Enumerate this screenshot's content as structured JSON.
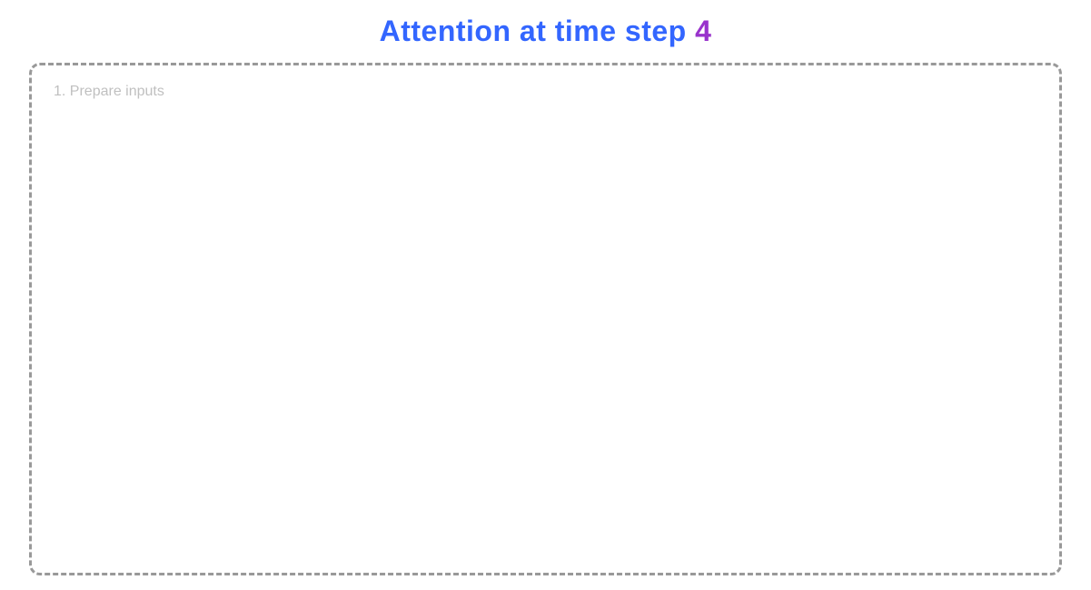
{
  "title": {
    "prefix": "Attention at time step ",
    "step": "4",
    "full": "Attention at time step 4"
  },
  "colors": {
    "title_blue": "#3366ff",
    "title_number_purple": "#9933cc",
    "border_dashed": "#999999",
    "list_text": "#c0c0c0"
  },
  "content": {
    "list_item_1": "1.  Prepare inputs"
  }
}
